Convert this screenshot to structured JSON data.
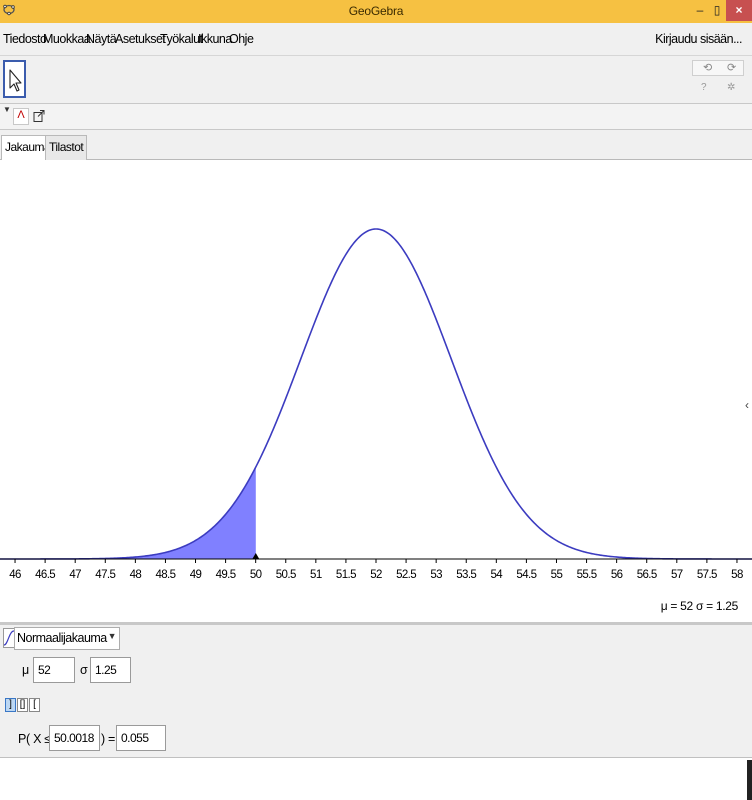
{
  "window": {
    "title": "GeoGebra",
    "min_label": "–",
    "max_label": "▯",
    "close_label": "×"
  },
  "menu": {
    "items": [
      "Tiedosto",
      "Muokkaa",
      "Näytä",
      "Asetukset",
      "Työkalut",
      "Ikkuna",
      "Ohje"
    ],
    "signin": "Kirjaudu sisään..."
  },
  "toolbar": {
    "undo_icon": "undo-icon",
    "redo_icon": "redo-icon",
    "help_icon": "help-icon",
    "settings_icon": "gear-icon"
  },
  "tabs": [
    "Jakauma",
    "Tilastot"
  ],
  "chart_data": {
    "type": "area",
    "distribution": "normal",
    "mean": 52,
    "sd": 1.25,
    "xlim": [
      45.75,
      58.25
    ],
    "x_ticks": [
      "46",
      "46.5",
      "47",
      "47.5",
      "48",
      "48.5",
      "49",
      "49.5",
      "50",
      "50.5",
      "51",
      "51.5",
      "52",
      "52.5",
      "53",
      "53.5",
      "54",
      "54.5",
      "55",
      "55.5",
      "56",
      "56.5",
      "57",
      "57.5",
      "58"
    ],
    "shaded_upper": 50.0018,
    "grid": false,
    "curve_color": "#3c3cc0",
    "fill_color": "#8080ff"
  },
  "params_label": "μ = 52   σ = 1.25",
  "controls": {
    "distribution": "Normaalijakauma",
    "mu_label": "μ",
    "mu_value": "52",
    "sigma_label": "σ",
    "sigma_value": "1.25",
    "interval_buttons": [
      "left-sided",
      "two-sided",
      "right-sided"
    ],
    "prob_prefix": "P( X ≤",
    "prob_bound": "50.0018",
    "prob_eq": ") =",
    "prob_value": "0.055"
  }
}
